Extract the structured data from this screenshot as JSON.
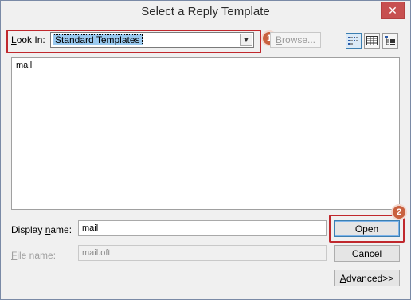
{
  "window": {
    "title": "Select a Reply Template",
    "close_glyph": "✕"
  },
  "look_in": {
    "label_underlined": "L",
    "label_rest": "ook In:",
    "selected": "Standard Templates",
    "dropdown_glyph": "▼",
    "browse_label_underlined": "B",
    "browse_label_rest": "rowse..."
  },
  "view_buttons": [
    {
      "name": "list-view-icon",
      "active": true
    },
    {
      "name": "details-view-icon",
      "active": false
    },
    {
      "name": "properties-view-icon",
      "active": false
    }
  ],
  "files": [
    {
      "name": "mail"
    }
  ],
  "display_name": {
    "label_prefix": "Display ",
    "label_underlined": "n",
    "label_rest": "ame:",
    "value": "mail"
  },
  "file_name": {
    "label_underlined": "F",
    "label_rest": "ile name:",
    "value": "mail.oft"
  },
  "buttons": {
    "open": "Open",
    "cancel": "Cancel",
    "advanced_underlined": "A",
    "advanced_rest": "dvanced>>"
  },
  "annotations": {
    "badge_1": "1",
    "badge_2": "2",
    "color": "#c9613f",
    "highlight_color": "#c0282d"
  }
}
